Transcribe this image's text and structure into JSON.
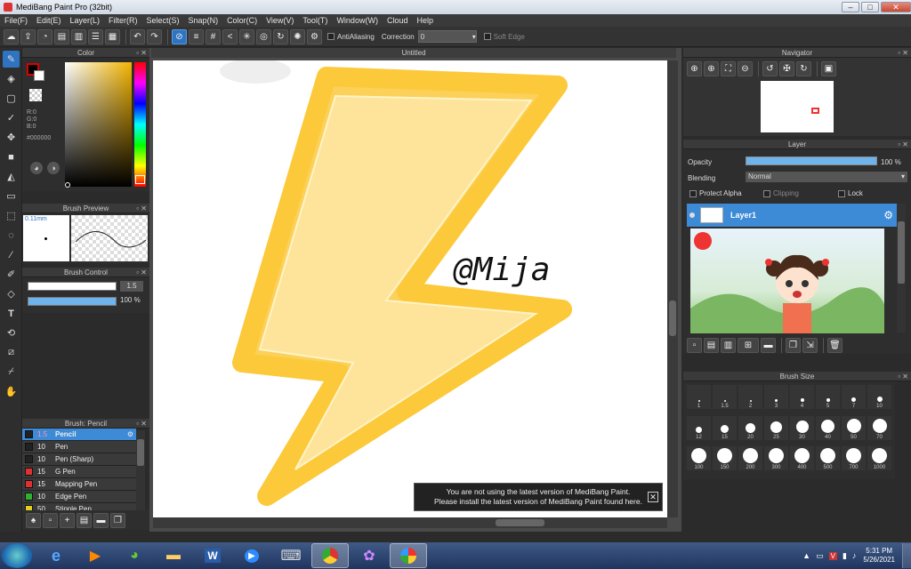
{
  "window": {
    "title": "MediBang Paint Pro (32bit)",
    "min": "–",
    "max": "□",
    "close": "✕"
  },
  "menu": [
    "File(F)",
    "Edit(E)",
    "Layer(L)",
    "Filter(R)",
    "Select(S)",
    "Snap(N)",
    "Color(C)",
    "View(V)",
    "Tool(T)",
    "Window(W)",
    "Cloud",
    "Help"
  ],
  "toolbar": {
    "antialiasing": "AntiAliasing",
    "correction_label": "Correction",
    "correction_value": "0",
    "soft_edge": "Soft Edge"
  },
  "color_panel": {
    "title": "Color",
    "r": "R:0",
    "g": "G:0",
    "b": "B:0",
    "hex": "#000000"
  },
  "brush_preview": {
    "title": "Brush Preview",
    "size": "0.11mm"
  },
  "brush_control": {
    "title": "Brush Control",
    "size": "1.5",
    "opacity": "100 %"
  },
  "brush_list": {
    "title": "Brush: Pencil",
    "items": [
      {
        "size": "1.5",
        "name": "Pencil",
        "color": "#222222"
      },
      {
        "size": "10",
        "name": "Pen",
        "color": "#222222"
      },
      {
        "size": "10",
        "name": "Pen (Sharp)",
        "color": "#222222"
      },
      {
        "size": "15",
        "name": "G Pen",
        "color": "#e03030"
      },
      {
        "size": "15",
        "name": "Mapping Pen",
        "color": "#e03030"
      },
      {
        "size": "10",
        "name": "Edge Pen",
        "color": "#30b030"
      },
      {
        "size": "50",
        "name": "Stipple Pen",
        "color": "#e0d020"
      }
    ]
  },
  "canvas": {
    "tab": "Untitled",
    "signature": "@Mija"
  },
  "notice": {
    "line1": "You are not using the latest version of MediBang Paint.",
    "line2": "Please install the latest version of MediBang Paint found here."
  },
  "navigator": {
    "title": "Navigator"
  },
  "layer_panel": {
    "title": "Layer",
    "opacity_label": "Opacity",
    "opacity_value": "100 %",
    "opacity": 1.0,
    "blending_label": "Blending",
    "blending_value": "Normal",
    "protect_alpha": "Protect Alpha",
    "clipping": "Clipping",
    "lock": "Lock",
    "layer_name": "Layer1"
  },
  "brush_size": {
    "title": "Brush Size",
    "sizes": [
      "1",
      "1.5",
      "2",
      "3",
      "4",
      "5",
      "7",
      "10",
      "12",
      "15",
      "20",
      "25",
      "30",
      "40",
      "50",
      "70",
      "100",
      "150",
      "200",
      "300",
      "400",
      "500",
      "700",
      "1000"
    ]
  },
  "taskbar": {
    "time": "5:31 PM",
    "date": "5/26/2021"
  },
  "colors": {
    "accent": "#2f74c0",
    "bolt": "#fcd15a",
    "bolt_inner": "#fde49a"
  }
}
